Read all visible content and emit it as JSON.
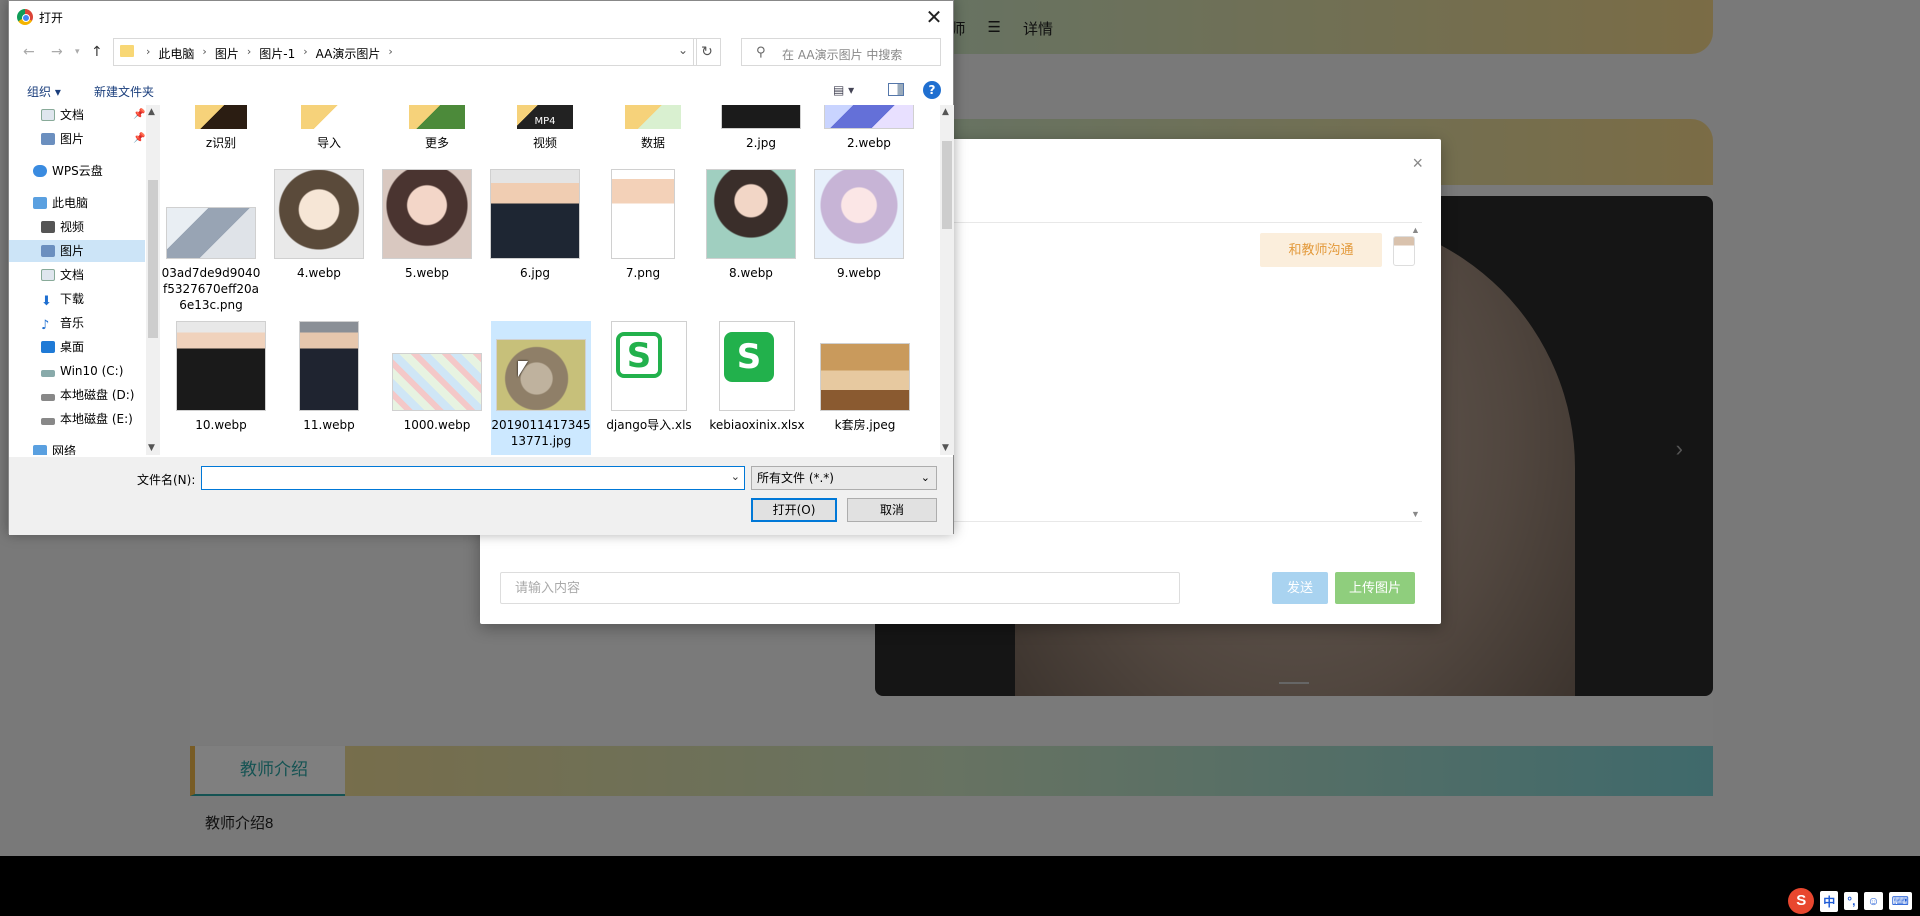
{
  "background_page": {
    "nav_items": [
      "师",
      "☰",
      "详情"
    ],
    "intro_tab": "教师介绍",
    "intro_text": "教师介绍8"
  },
  "chat_modal": {
    "close_glyph": "×",
    "bubble_text": "和教师沟通",
    "input_placeholder": "请输入内容",
    "send_label": "发送",
    "upload_label": "上传图片",
    "accent_colors": {
      "send": "#a9d3f0",
      "upload": "#8fce7d",
      "bubble": "#fbeedc"
    }
  },
  "dialog": {
    "title": "打开",
    "close_glyph": "✕",
    "breadcrumbs": [
      "此电脑",
      "图片",
      "图片-1",
      "AA演示图片"
    ],
    "search_placeholder": "在 AA演示图片 中搜索",
    "toolbar": {
      "organize": "组织 ▾",
      "new_folder": "新建文件夹",
      "help": "?"
    },
    "sidebar": [
      {
        "label": "文档",
        "icon": "document-icon",
        "pinned": true
      },
      {
        "label": "图片",
        "icon": "pictures-icon",
        "pinned": true
      },
      {
        "label": "WPS云盘",
        "icon": "cloud-icon"
      },
      {
        "label": "此电脑",
        "icon": "computer-icon"
      },
      {
        "label": "视频",
        "icon": "video-icon"
      },
      {
        "label": "图片",
        "icon": "pictures-icon",
        "selected": true
      },
      {
        "label": "文档",
        "icon": "document-icon"
      },
      {
        "label": "下载",
        "icon": "download-icon"
      },
      {
        "label": "音乐",
        "icon": "music-icon"
      },
      {
        "label": "桌面",
        "icon": "desktop-icon"
      },
      {
        "label": "Win10 (C:)",
        "icon": "drive-icon"
      },
      {
        "label": "本地磁盘 (D:)",
        "icon": "drive-icon"
      },
      {
        "label": "本地磁盘 (E:)",
        "icon": "drive-icon"
      },
      {
        "label": "网络",
        "icon": "network-icon"
      }
    ],
    "files_row1": [
      {
        "name": "z识别",
        "kind": "folder-photo"
      },
      {
        "name": "导入",
        "kind": "folder"
      },
      {
        "name": "更多",
        "kind": "folder"
      },
      {
        "name": "视频",
        "kind": "folder-mp4"
      },
      {
        "name": "数据",
        "kind": "folder"
      },
      {
        "name": "2.jpg",
        "kind": "image-dark"
      },
      {
        "name": "2.webp",
        "kind": "image-anime"
      }
    ],
    "files_row2": [
      {
        "name": "03ad7de9d9040f5327670eff20a6e13c.png",
        "kind": "image-phone"
      },
      {
        "name": "4.webp",
        "kind": "image-anime-boy"
      },
      {
        "name": "5.webp",
        "kind": "image-girl"
      },
      {
        "name": "6.jpg",
        "kind": "image-man-suit"
      },
      {
        "name": "7.png",
        "kind": "image-doctor"
      },
      {
        "name": "8.webp",
        "kind": "image-girl-art"
      },
      {
        "name": "9.webp",
        "kind": "image-girl-light"
      }
    ],
    "files_row3": [
      {
        "name": "10.webp",
        "kind": "image-man-suit-light"
      },
      {
        "name": "11.webp",
        "kind": "image-man-suit-dark"
      },
      {
        "name": "1000.webp",
        "kind": "image-map"
      },
      {
        "name": "201901141734513771.jpg",
        "kind": "image-cat",
        "selected": true
      },
      {
        "name": "django导入.xls",
        "kind": "wps-sheet-outline"
      },
      {
        "name": "kebiaoxinix.xlsx",
        "kind": "wps-sheet-green"
      },
      {
        "name": "k套房.jpeg",
        "kind": "image-room"
      }
    ],
    "filename_label": "文件名(N):",
    "filename_value": "",
    "filetype_value": "所有文件 (*.*)",
    "open_label": "打开(O)",
    "cancel_label": "取消"
  },
  "taskbar": {
    "ime_logo": "S",
    "ime_mode": "中",
    "ime_punct": "°,",
    "tray_icons": [
      "emoji-icon",
      "keyboard-icon"
    ]
  }
}
